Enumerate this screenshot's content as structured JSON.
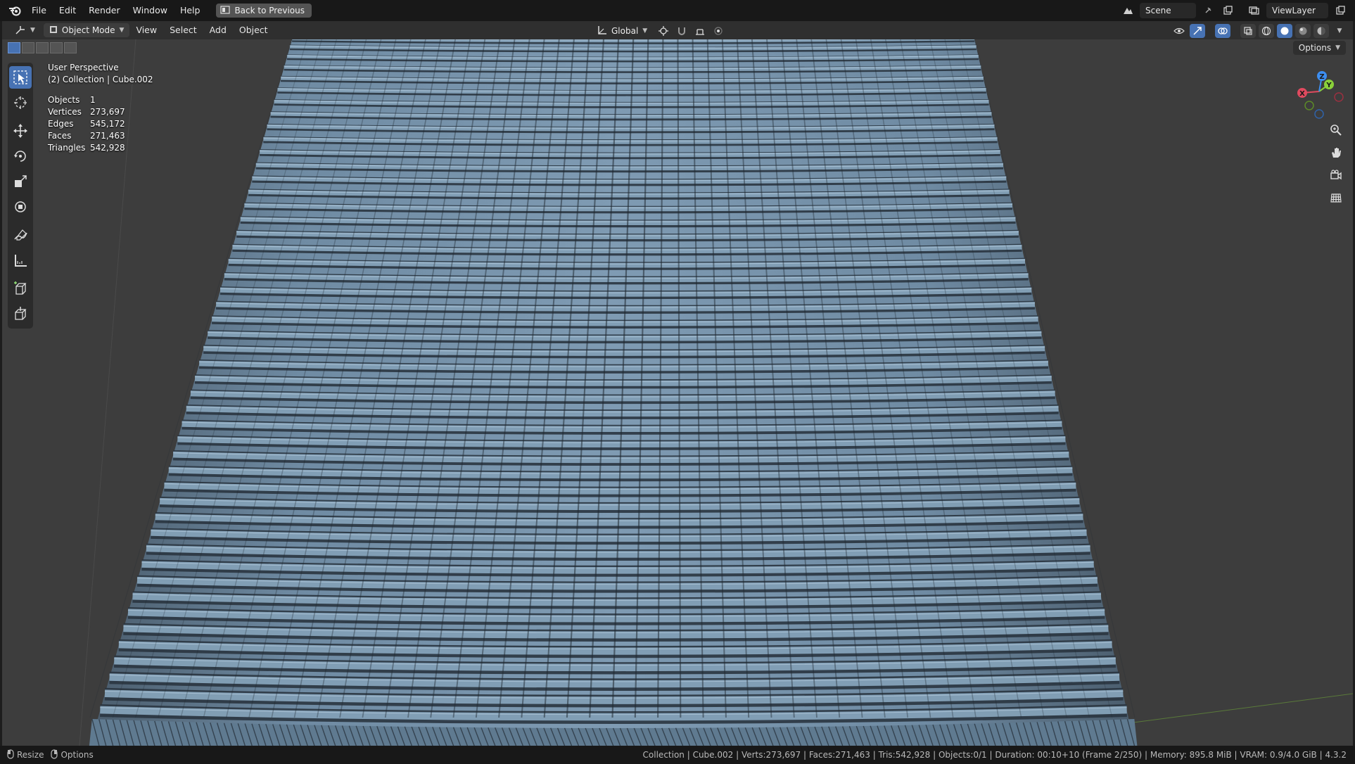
{
  "topbar": {
    "menus": [
      "File",
      "Edit",
      "Render",
      "Window",
      "Help"
    ],
    "back_button": "Back to Previous",
    "scene": "Scene",
    "view_layer": "ViewLayer"
  },
  "viewport_header": {
    "mode": "Object Mode",
    "menus": [
      "View",
      "Select",
      "Add",
      "Object"
    ],
    "transform_orientation": "Global",
    "options": "Options"
  },
  "overlay": {
    "view_name": "User Perspective",
    "collection": "(2) Collection | Cube.002",
    "stats": [
      {
        "label": "Objects",
        "value": "1"
      },
      {
        "label": "Vertices",
        "value": "273,697"
      },
      {
        "label": "Edges",
        "value": "545,172"
      },
      {
        "label": "Faces",
        "value": "271,463"
      },
      {
        "label": "Triangles",
        "value": "542,928"
      }
    ]
  },
  "gizmo": {
    "x": "X",
    "y": "Y",
    "z": "Z"
  },
  "statusbar": {
    "left_resize": "Resize",
    "left_options": "Options",
    "info": "Collection | Cube.002 | Verts:273,697 | Faces:271,463 | Tris:542,928 | Objects:0/1 | Duration: 00:10+10 (Frame 2/250) | Memory: 895.8 MiB | VRAM: 0.9/4.0 GiB | 4.3.2"
  },
  "colors": {
    "header_bg": "#181818",
    "viewport_bg": "#3d3d3d",
    "accent": "#4772b3",
    "mesh": "#6f8ba3"
  },
  "icons": [
    "blender-logo-icon",
    "back-icon",
    "scene-icon",
    "pin-icon",
    "viewlayer-icon",
    "editor-type-icon",
    "object-mode-icon",
    "orientation-icon",
    "pivot-icon",
    "snap-icon",
    "proportional-icon",
    "visibility-icon",
    "gizmo-toggle-icon",
    "overlay-icon",
    "xray-icon",
    "wireframe-shading-icon",
    "solid-shading-icon",
    "material-shading-icon",
    "rendered-shading-icon",
    "select-box-icon",
    "cursor-icon",
    "move-icon",
    "rotate-icon",
    "scale-icon",
    "transform-icon",
    "annotate-icon",
    "measure-icon",
    "add-cube-icon",
    "zoom-icon",
    "pan-hand-icon",
    "camera-icon",
    "grid-icon"
  ]
}
